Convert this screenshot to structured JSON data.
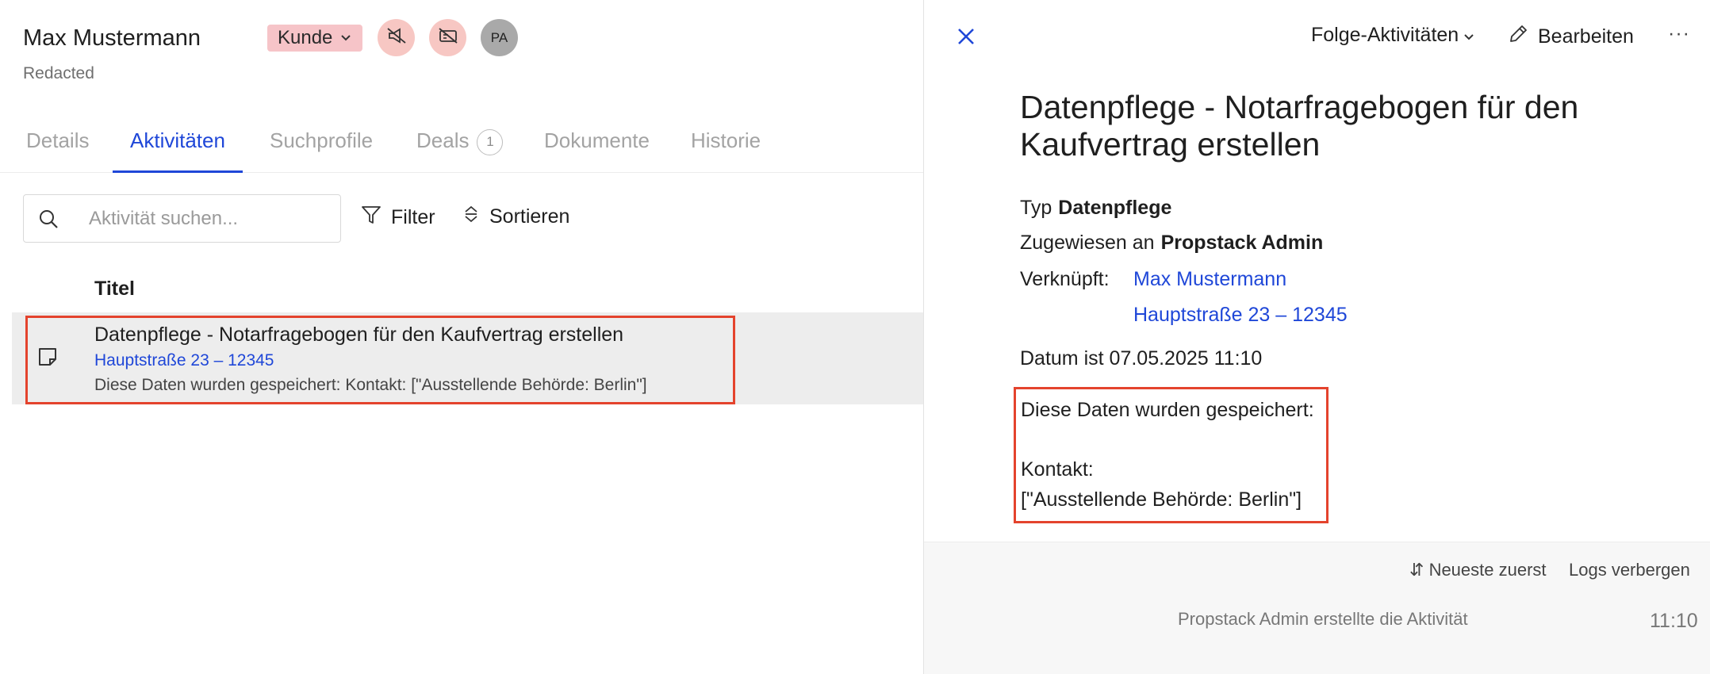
{
  "contact": {
    "name": "Max Mustermann",
    "subtitle": "Redacted",
    "status_badge": "Kunde",
    "avatar_initials": "PA"
  },
  "tabs": [
    {
      "label": "Details",
      "active": false
    },
    {
      "label": "Aktivitäten",
      "active": true
    },
    {
      "label": "Suchprofile",
      "active": false
    },
    {
      "label": "Deals",
      "count": "1",
      "active": false
    },
    {
      "label": "Dokumente",
      "active": false
    },
    {
      "label": "Historie",
      "active": false
    }
  ],
  "toolbar": {
    "search_placeholder": "Aktivität suchen...",
    "filter_label": "Filter",
    "sort_label": "Sortieren"
  },
  "table": {
    "column_title": "Titel",
    "rows": [
      {
        "title": "Datenpflege - Notarfragebogen für den Kaufvertrag erstellen",
        "link": "Hauptstraße 23 – 12345",
        "description": "Diese Daten wurden gespeichert: Kontakt: [\"Ausstellende Behörde: Berlin\"]"
      }
    ]
  },
  "detail": {
    "actions": {
      "follow_up": "Folge-Aktivitäten",
      "edit": "Bearbeiten",
      "more": "···"
    },
    "title": "Datenpflege - Notarfragebogen für den Kaufvertrag erstellen",
    "type_label": "Typ",
    "type_value": "Datenpflege",
    "assigned_label": "Zugewiesen an",
    "assigned_value": "Propstack Admin",
    "linked_label": "Verknüpft:",
    "linked_items": [
      "Max Mustermann",
      "Hauptstraße 23 – 12345"
    ],
    "date_label": "Datum ist",
    "date_value": "07.05.2025 11:10",
    "body_lines": [
      "Diese Daten wurden gespeichert:",
      "Kontakt:",
      "[\"Ausstellende Behörde: Berlin\"]"
    ]
  },
  "logs": {
    "sort_label": "Neueste zuerst",
    "hide_label": "Logs verbergen",
    "entries": [
      {
        "text": "Propstack Admin erstellte die Aktivität",
        "time": "11:10"
      }
    ]
  },
  "colors": {
    "accent": "#1f47d8",
    "highlight": "#e4432d",
    "badge": "#f6c4c8"
  }
}
